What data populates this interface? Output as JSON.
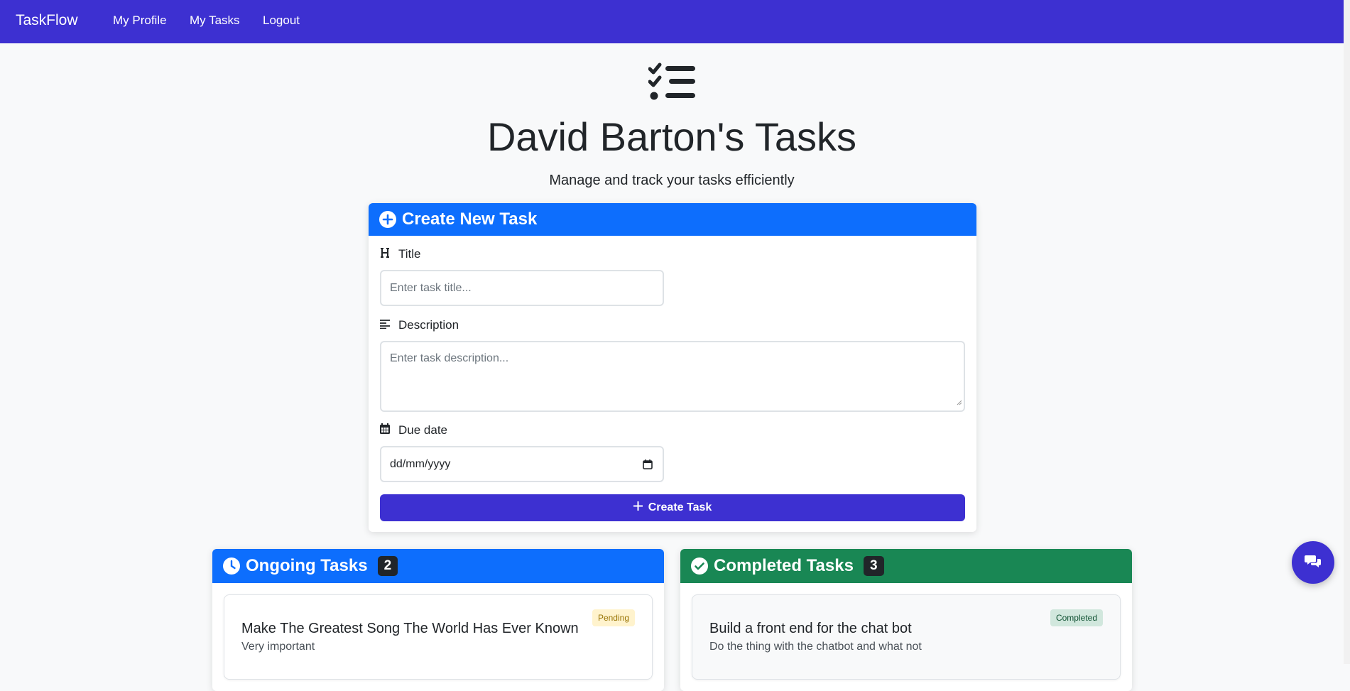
{
  "nav": {
    "brand": "TaskFlow",
    "links": [
      "My Profile",
      "My Tasks",
      "Logout"
    ]
  },
  "hero": {
    "icon": "task-list-icon",
    "title": "David Barton's Tasks",
    "subtitle": "Manage and track your tasks efficiently"
  },
  "create_form": {
    "header": "Create New Task",
    "header_icon": "plus-circle-icon",
    "title_label": "Title",
    "title_placeholder": "Enter task title...",
    "description_label": "Description",
    "description_placeholder": "Enter task description...",
    "due_label": "Due date",
    "due_value": "dd/mm/yyyy",
    "submit_label": "Create Task"
  },
  "ongoing": {
    "header": "Ongoing Tasks",
    "count": "2",
    "items": [
      {
        "title": "Make The Greatest Song The World Has Ever Known",
        "description": "Very important",
        "status": "Pending"
      }
    ]
  },
  "completed": {
    "header": "Completed Tasks",
    "count": "3",
    "items": [
      {
        "title": "Build a front end for the chat bot",
        "description": "Do the thing with the chatbot and what not",
        "status": "Completed"
      }
    ]
  },
  "colors": {
    "primary": "#3d30d1",
    "header_blue": "#0d6efd",
    "header_green": "#198754"
  }
}
